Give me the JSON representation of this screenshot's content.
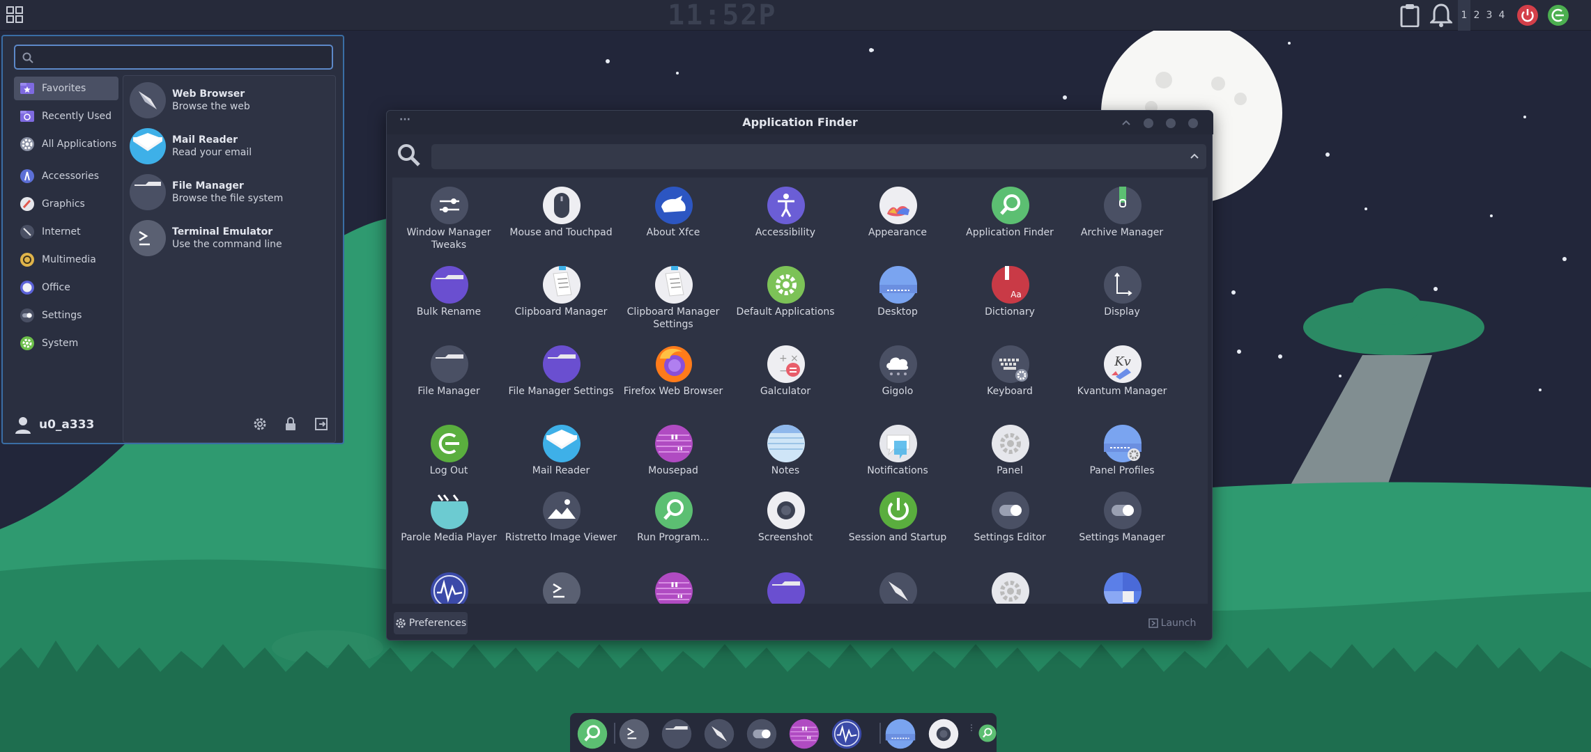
{
  "top_panel": {
    "clock": "11:52P",
    "workspaces": [
      "1",
      "2",
      "3",
      "4"
    ],
    "icons": [
      "applications-menu-icon",
      "clipboard-icon",
      "notification-bell-icon",
      "power-icon",
      "logout-icon"
    ]
  },
  "whisker_menu": {
    "search_placeholder": "",
    "categories": [
      {
        "label": "Favorites",
        "icon": "star-folder-icon",
        "selected": true
      },
      {
        "label": "Recently Used",
        "icon": "recent-folder-icon"
      },
      {
        "label": "All Applications",
        "icon": "gear-icon"
      },
      {
        "label": "Accessories",
        "icon": "accessories-icon"
      },
      {
        "label": "Graphics",
        "icon": "graphics-icon"
      },
      {
        "label": "Internet",
        "icon": "compass-icon"
      },
      {
        "label": "Multimedia",
        "icon": "multimedia-icon"
      },
      {
        "label": "Office",
        "icon": "office-icon"
      },
      {
        "label": "Settings",
        "icon": "toggle-icon"
      },
      {
        "label": "System",
        "icon": "system-gear-icon"
      }
    ],
    "favorites": [
      {
        "title": "Web Browser",
        "desc": "Browse the web",
        "icon": "compass-icon"
      },
      {
        "title": "Mail Reader",
        "desc": "Read your email",
        "icon": "mail-icon"
      },
      {
        "title": "File Manager",
        "desc": "Browse the file system",
        "icon": "folder-icon"
      },
      {
        "title": "Terminal Emulator",
        "desc": "Use the command line",
        "icon": "terminal-icon"
      }
    ],
    "username": "u0_a333"
  },
  "app_finder": {
    "title": "Application Finder",
    "search_value": "",
    "apps": [
      {
        "label": "Window Manager Tweaks",
        "icon": "sliders-icon"
      },
      {
        "label": "Mouse and Touchpad",
        "icon": "mouse-icon"
      },
      {
        "label": "About Xfce",
        "icon": "xfce-mouse-icon"
      },
      {
        "label": "Accessibility",
        "icon": "accessibility-icon"
      },
      {
        "label": "Appearance",
        "icon": "appearance-icon"
      },
      {
        "label": "Application Finder",
        "icon": "search-icon"
      },
      {
        "label": "Archive Manager",
        "icon": "archive-icon"
      },
      {
        "label": "Bulk Rename",
        "icon": "folder-purple-icon"
      },
      {
        "label": "Clipboard Manager",
        "icon": "clipboard-icon"
      },
      {
        "label": "Clipboard Manager Settings",
        "icon": "clipboard-icon"
      },
      {
        "label": "Default Applications",
        "icon": "gear-icon"
      },
      {
        "label": "Desktop",
        "icon": "desktop-icon"
      },
      {
        "label": "Dictionary",
        "icon": "dictionary-icon"
      },
      {
        "label": "Display",
        "icon": "display-icon"
      },
      {
        "label": "File Manager",
        "icon": "folder-icon"
      },
      {
        "label": "File Manager Settings",
        "icon": "folder-purple-icon"
      },
      {
        "label": "Firefox Web Browser",
        "icon": "firefox-icon"
      },
      {
        "label": "Galculator",
        "icon": "calculator-icon"
      },
      {
        "label": "Gigolo",
        "icon": "cloud-icon"
      },
      {
        "label": "Keyboard",
        "icon": "keyboard-icon"
      },
      {
        "label": "Kvantum Manager",
        "icon": "kvantum-icon"
      },
      {
        "label": "Log Out",
        "icon": "logout-icon"
      },
      {
        "label": "Mail Reader",
        "icon": "mail-icon"
      },
      {
        "label": "Mousepad",
        "icon": "mousepad-icon"
      },
      {
        "label": "Notes",
        "icon": "notes-icon"
      },
      {
        "label": "Notifications",
        "icon": "notifications-icon"
      },
      {
        "label": "Panel",
        "icon": "panel-gear-icon"
      },
      {
        "label": "Panel Profiles",
        "icon": "panel-profiles-icon"
      },
      {
        "label": "Parole Media Player",
        "icon": "media-player-icon"
      },
      {
        "label": "Ristretto Image Viewer",
        "icon": "image-viewer-icon"
      },
      {
        "label": "Run Program...",
        "icon": "search-icon"
      },
      {
        "label": "Screenshot",
        "icon": "screenshot-icon"
      },
      {
        "label": "Session and Startup",
        "icon": "power-icon"
      },
      {
        "label": "Settings Editor",
        "icon": "toggle-icon"
      },
      {
        "label": "Settings Manager",
        "icon": "toggle-icon"
      },
      {
        "label": "",
        "icon": "task-manager-icon"
      },
      {
        "label": "",
        "icon": "terminal-icon"
      },
      {
        "label": "",
        "icon": "mousepad-icon"
      },
      {
        "label": "",
        "icon": "folder-purple-icon"
      },
      {
        "label": "",
        "icon": "compass-icon"
      },
      {
        "label": "",
        "icon": "panel-gear-icon"
      },
      {
        "label": "",
        "icon": "workspaces-icon"
      }
    ],
    "preferences_label": "Preferences",
    "launch_label": "Launch"
  },
  "dock": {
    "items": [
      "search-icon",
      "terminal-icon",
      "folder-icon",
      "compass-icon",
      "toggle-icon",
      "mousepad-icon",
      "task-manager-icon",
      "desktop-icon",
      "screenshot-icon",
      "search-icon"
    ]
  },
  "colors": {
    "panel": "#262a3a",
    "accent_blue": "#5d89c9",
    "green": "#4caf50",
    "red_power": "#d33f49",
    "purple": "#6a4fd0"
  }
}
